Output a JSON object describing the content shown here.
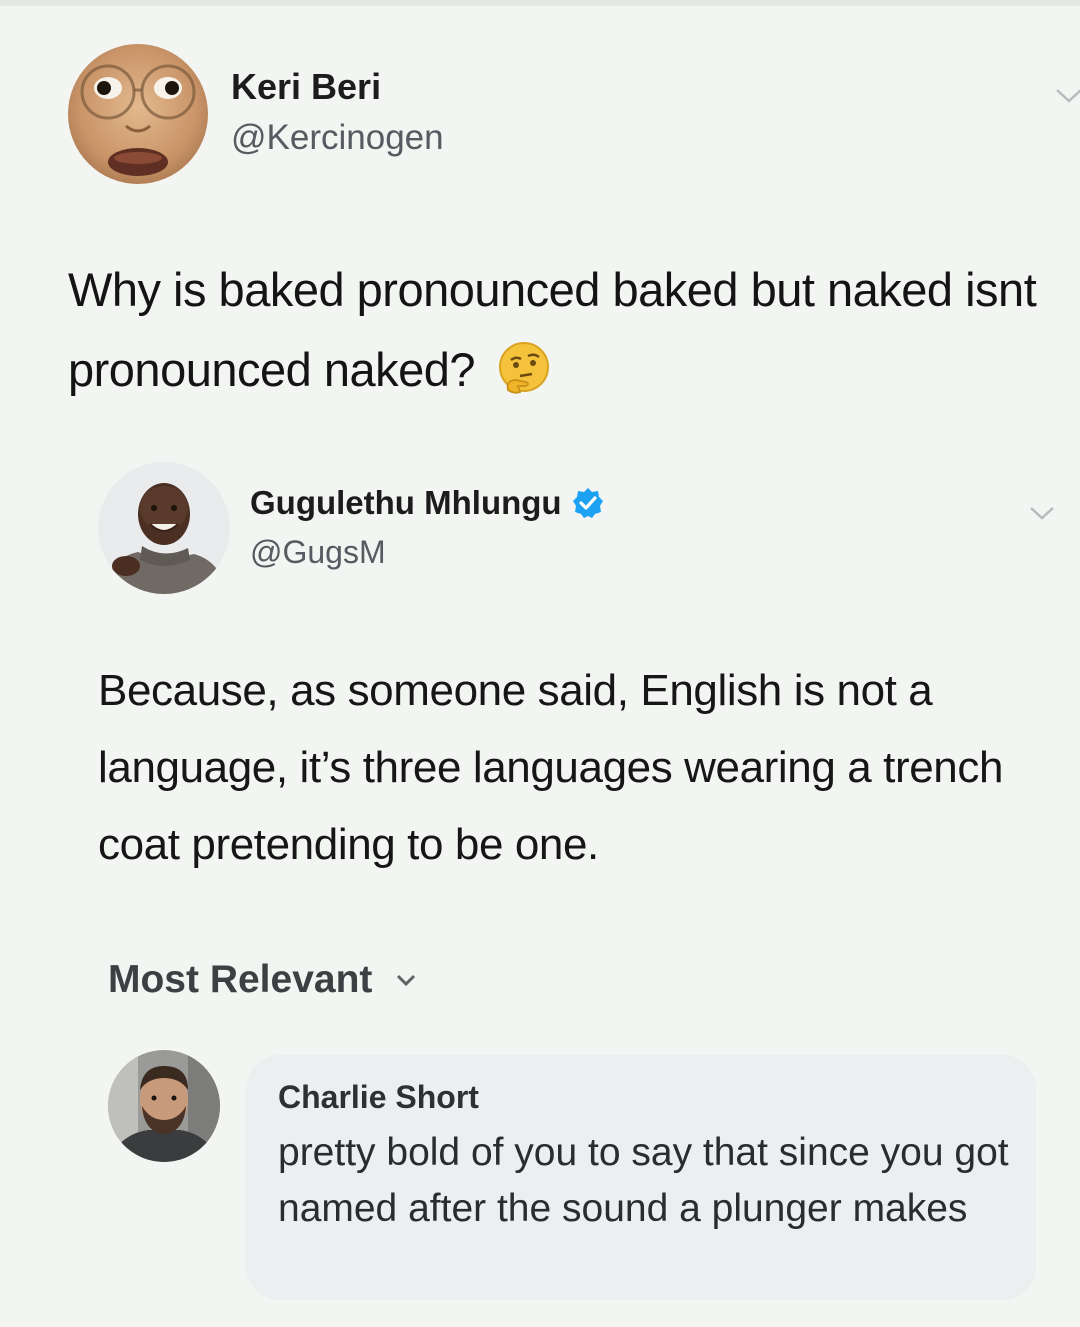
{
  "original_tweet": {
    "author_name": "Keri Beri",
    "author_handle": "@Kercinogen",
    "text": "Why is baked pronounced baked but naked isnt pronounced naked?",
    "emoji": "thinking-face"
  },
  "reply_tweet": {
    "author_name": "Gugulethu Mhlungu",
    "verified": true,
    "author_handle": "@GugsM",
    "text": "Because, as someone said, English is not a language, it’s three languages wearing a trench coat pretending to be one."
  },
  "comments_section": {
    "sort_label": "Most Relevant",
    "comments": [
      {
        "author_name": "Charlie Short",
        "text": "pretty bold of you to say that since you got named after the sound a plunger makes"
      }
    ]
  },
  "colors": {
    "background": "#f3f5f3",
    "verified_blue": "#1da1f2",
    "bubble": "#eceeef"
  }
}
